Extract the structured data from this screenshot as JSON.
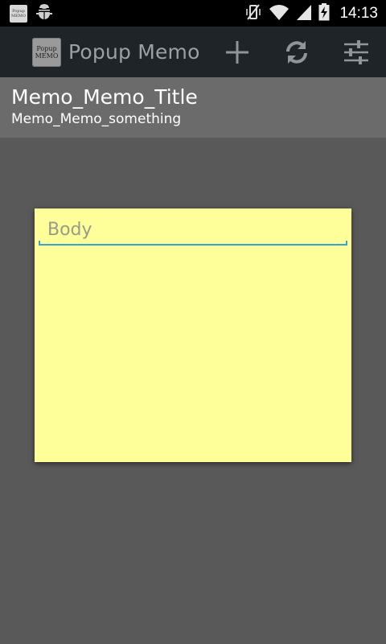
{
  "status_bar": {
    "time": "14:13",
    "app_icon_text": [
      "Popup",
      "MEMO"
    ],
    "icons": [
      "popup-memo-notification-icon",
      "android-debug-icon",
      "vibrate-icon",
      "wifi-icon",
      "signal-icon",
      "battery-charging-icon"
    ]
  },
  "action_bar": {
    "logo_text": [
      "Popup",
      "MEMO"
    ],
    "title": "Popup Memo",
    "actions": [
      "add-icon",
      "refresh-icon",
      "settings-sliders-icon"
    ]
  },
  "memo_list": {
    "items": [
      {
        "title": "Memo_Memo_Title",
        "subtitle": "Memo_Memo_something"
      }
    ]
  },
  "memo_editor": {
    "body_placeholder": "Body",
    "background_color": "#ffff9a",
    "accent_color": "#3aa6d0"
  }
}
